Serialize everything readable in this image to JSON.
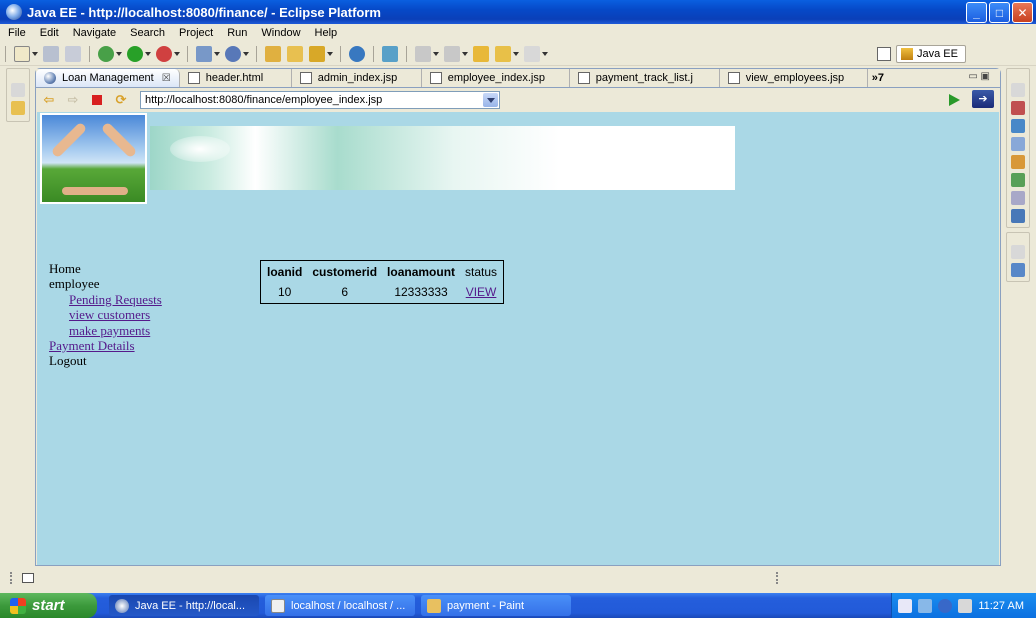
{
  "window": {
    "title": "Java EE - http://localhost:8080/finance/ - Eclipse Platform"
  },
  "menu": [
    "File",
    "Edit",
    "Navigate",
    "Search",
    "Project",
    "Run",
    "Window",
    "Help"
  ],
  "perspective": {
    "label": "Java EE"
  },
  "editor_tabs": [
    {
      "label": "Loan Management",
      "active": true,
      "icon": "globe-icon"
    },
    {
      "label": "header.html",
      "active": false,
      "icon": "file-icon"
    },
    {
      "label": "admin_index.jsp",
      "active": false,
      "icon": "file-icon"
    },
    {
      "label": "employee_index.jsp",
      "active": false,
      "icon": "file-icon"
    },
    {
      "label": "payment_track_list.j",
      "active": false,
      "icon": "file-icon"
    },
    {
      "label": "view_employees.jsp",
      "active": false,
      "icon": "file-icon"
    }
  ],
  "tabs_overflow": "»7",
  "browser": {
    "url": "http://localhost:8080/finance/employee_index.jsp"
  },
  "page": {
    "nav": {
      "home": "Home",
      "employee": "employee",
      "pending": "Pending Requests",
      "view_customers": "view customers",
      "make_payments": "make payments",
      "payment_details": "Payment Details",
      "logout": "Logout"
    },
    "table": {
      "headers": [
        "loanid",
        "customerid",
        "loanamount",
        "status"
      ],
      "rows": [
        {
          "loanid": "10",
          "customerid": "6",
          "loanamount": "12333333",
          "status": "VIEW"
        }
      ]
    }
  },
  "taskbar": {
    "start": "start",
    "tasks": [
      {
        "label": "Java EE - http://local...",
        "active": true
      },
      {
        "label": "localhost / localhost / ...",
        "active": false
      },
      {
        "label": "payment - Paint",
        "active": false
      }
    ],
    "clock": "11:27 AM"
  },
  "colors": {
    "page_bg": "#aad8e6",
    "visited_link": "#551a8b",
    "titlebar": "#0649c8"
  }
}
